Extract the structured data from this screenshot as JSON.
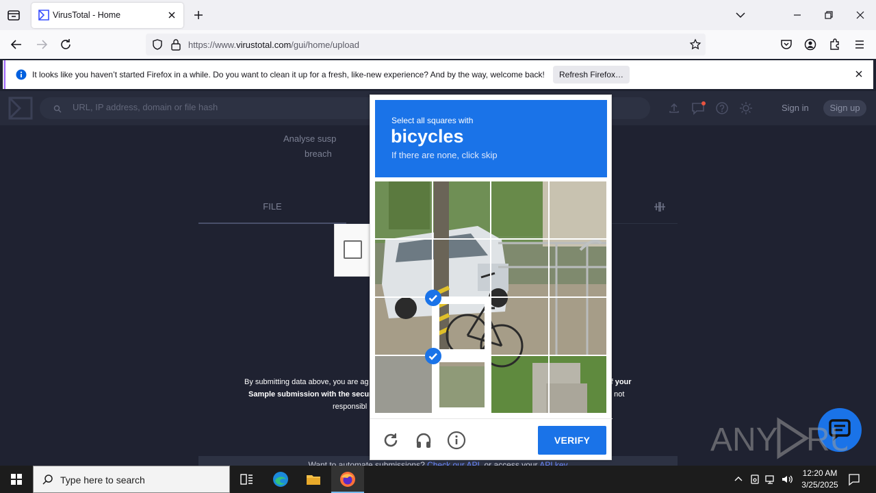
{
  "browser": {
    "tab_title": "VirusTotal - Home",
    "url_prefix": "https://www.",
    "url_host": "virustotal.com",
    "url_path": "/gui/home/upload"
  },
  "notification": {
    "message": "It looks like you haven’t started Firefox in a while. Do you want to clean it up for a fresh, like-new experience? And by the way, welcome back!",
    "button_label": "Refresh Firefox…"
  },
  "virustotal": {
    "search_placeholder": "URL, IP address, domain or file hash",
    "sign_in": "Sign in",
    "sign_up": "Sign up",
    "desc_line1": "Analyse susp",
    "desc_line2": "breach",
    "tab_file": "FILE",
    "terms_line1_left": "By submitting data above, you are ag",
    "terms_line1_right": "f your",
    "terms_line2_left": "Sample submission with the secur",
    "terms_line2_right": "e not",
    "terms_line3_left": "responsibl",
    "api_text": "Want to automate submissions?",
    "api_link1": "Check our API",
    "api_mid": ", or access your",
    "api_link2": "API key"
  },
  "captcha": {
    "prompt": "Select all squares with",
    "target_word": "bicycles",
    "skip_hint": "If there are none, click skip",
    "verify_label": "VERIFY",
    "selected_tiles": [
      9,
      13
    ]
  },
  "watermark": "ANY RUN",
  "taskbar": {
    "search_placeholder": "Type here to search",
    "time": "12:20 AM",
    "date": "3/25/2025"
  },
  "colors": {
    "captcha_blue": "#1a73e8",
    "vt_background": "#1f2231",
    "taskbar": "#1c1c1c"
  }
}
